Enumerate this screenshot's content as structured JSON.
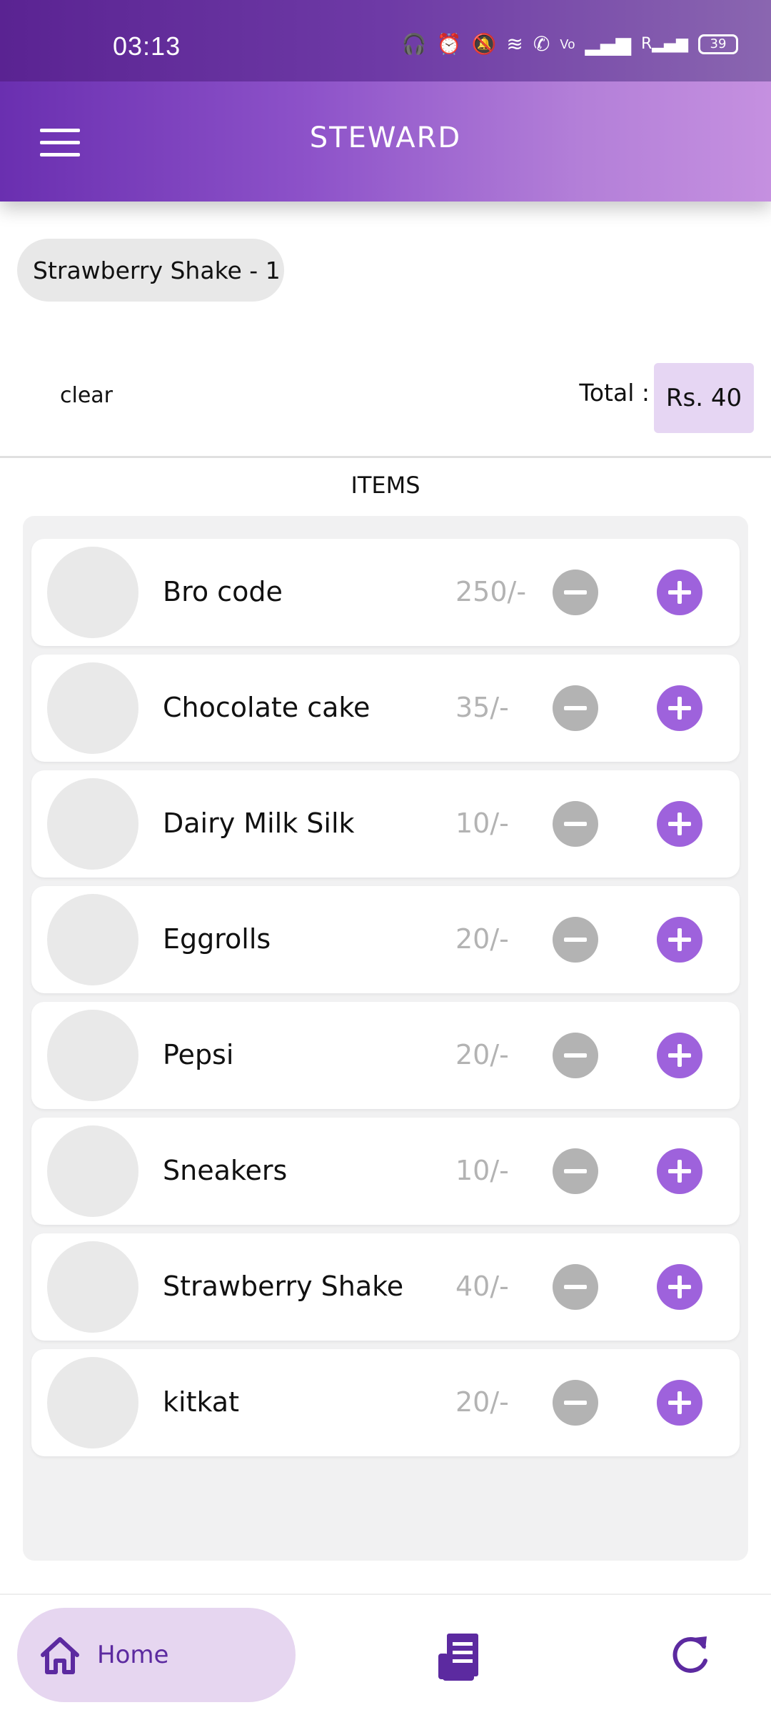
{
  "status_bar": {
    "time": "03:13",
    "battery": "39"
  },
  "app_bar": {
    "title": "STEWARD"
  },
  "order_chip": "Strawberry Shake - 1",
  "summary": {
    "clear_label": "clear",
    "total_label": "Total :",
    "total_value": "Rs. 40"
  },
  "items_heading": "ITEMS",
  "items": [
    {
      "name": "Bro code",
      "price": "250/-"
    },
    {
      "name": "Chocolate cake",
      "price": "35/-"
    },
    {
      "name": "Dairy Milk Silk",
      "price": "10/-"
    },
    {
      "name": "Eggrolls",
      "price": "20/-"
    },
    {
      "name": "Pepsi",
      "price": "20/-"
    },
    {
      "name": "Sneakers",
      "price": "10/-"
    },
    {
      "name": "Strawberry Shake",
      "price": "40/-"
    },
    {
      "name": "kitkat",
      "price": "20/-"
    }
  ],
  "bottom_nav": {
    "home_label": "Home"
  },
  "colors": {
    "accent": "#9e62dc",
    "nav_accent": "#5c2aa0",
    "chip_bg": "#e8e8e8",
    "total_bg": "#e6d6f3"
  }
}
